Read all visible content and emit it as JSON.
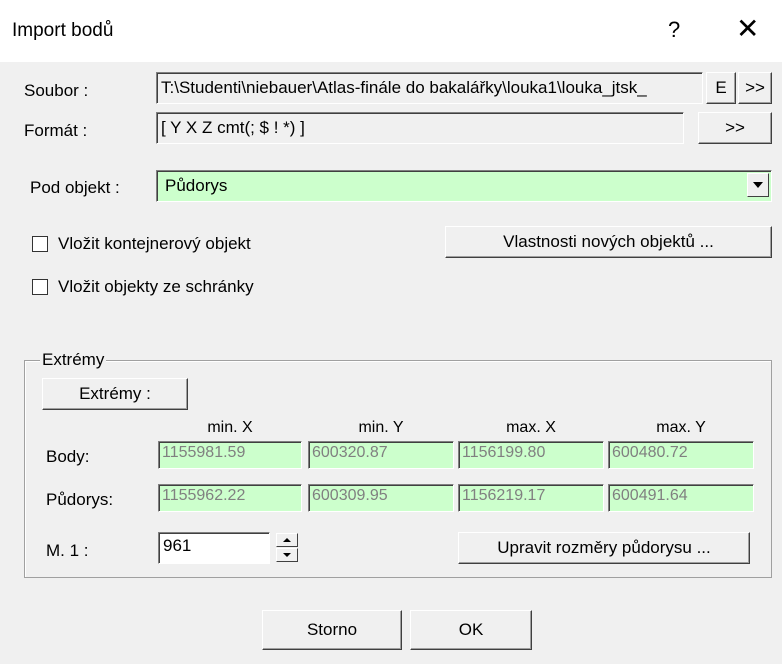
{
  "window": {
    "title": "Import bodů",
    "help": "?",
    "close": "✕"
  },
  "file": {
    "label": "Soubor :",
    "value": "T:\\Studenti\\niebauer\\Atlas-finále do bakalářky\\louka1\\louka_jtsk_",
    "e_button": "E",
    "more_button": ">>"
  },
  "format": {
    "label": "Formát :",
    "value": "[ Y X Z cmt(; $ ! *) ]",
    "more_button": ">>"
  },
  "under_object": {
    "label": "Pod objekt :",
    "selected": "Půdorys"
  },
  "checkboxes": {
    "container": "Vložit kontejnerový objekt",
    "clipboard": "Vložit objekty ze schránky"
  },
  "new_props_button": "Vlastnosti nových objektů ...",
  "extremes": {
    "group_title": "Extrémy",
    "button": "Extrémy :",
    "columns": [
      "min. X",
      "min. Y",
      "max. X",
      "max. Y"
    ],
    "rows": [
      {
        "label": "Body:",
        "values": [
          "1155981.59",
          "600320.87",
          "1156199.80",
          "600480.72"
        ]
      },
      {
        "label": "Půdorys:",
        "values": [
          "1155962.22",
          "600309.95",
          "1156219.17",
          "600491.64"
        ]
      }
    ],
    "scale_label": "M. 1 :",
    "scale_value": "961",
    "adjust_button": "Upravit rozměry půdorysu ..."
  },
  "footer": {
    "cancel": "Storno",
    "ok": "OK"
  }
}
